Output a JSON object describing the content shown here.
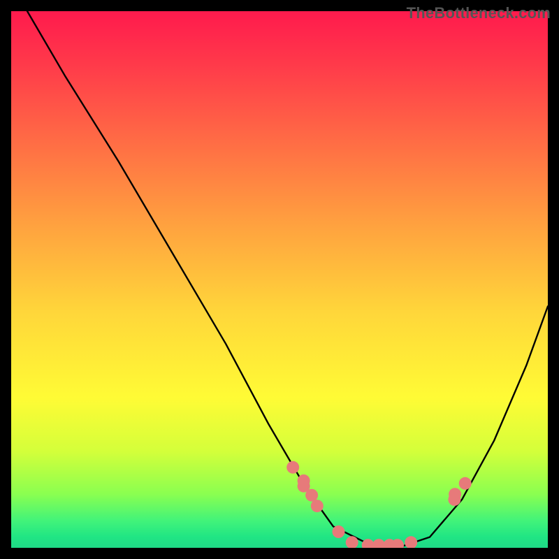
{
  "watermark": "TheBottleneck.com",
  "chart_data": {
    "type": "line",
    "title": "",
    "xlabel": "",
    "ylabel": "",
    "xlim": [
      0,
      1
    ],
    "ylim": [
      0,
      1
    ],
    "series": [
      {
        "name": "curve",
        "x": [
          0.03,
          0.1,
          0.2,
          0.3,
          0.4,
          0.48,
          0.55,
          0.6,
          0.66,
          0.72,
          0.78,
          0.84,
          0.9,
          0.96,
          1.0
        ],
        "y": [
          1.0,
          0.88,
          0.72,
          0.55,
          0.38,
          0.23,
          0.11,
          0.04,
          0.01,
          0.0,
          0.02,
          0.09,
          0.2,
          0.34,
          0.45
        ]
      }
    ],
    "markers": {
      "name": "highlight-points",
      "x": [
        0.525,
        0.545,
        0.545,
        0.56,
        0.57,
        0.61,
        0.635,
        0.665,
        0.685,
        0.705,
        0.72,
        0.745,
        0.826,
        0.827,
        0.846
      ],
      "y": [
        0.15,
        0.125,
        0.115,
        0.098,
        0.078,
        0.03,
        0.01,
        0.005,
        0.005,
        0.005,
        0.005,
        0.01,
        0.09,
        0.1,
        0.12
      ]
    },
    "background_gradient": {
      "top": "#ff1a4d",
      "mid": "#fffb35",
      "bottom": "#1fd986"
    }
  }
}
